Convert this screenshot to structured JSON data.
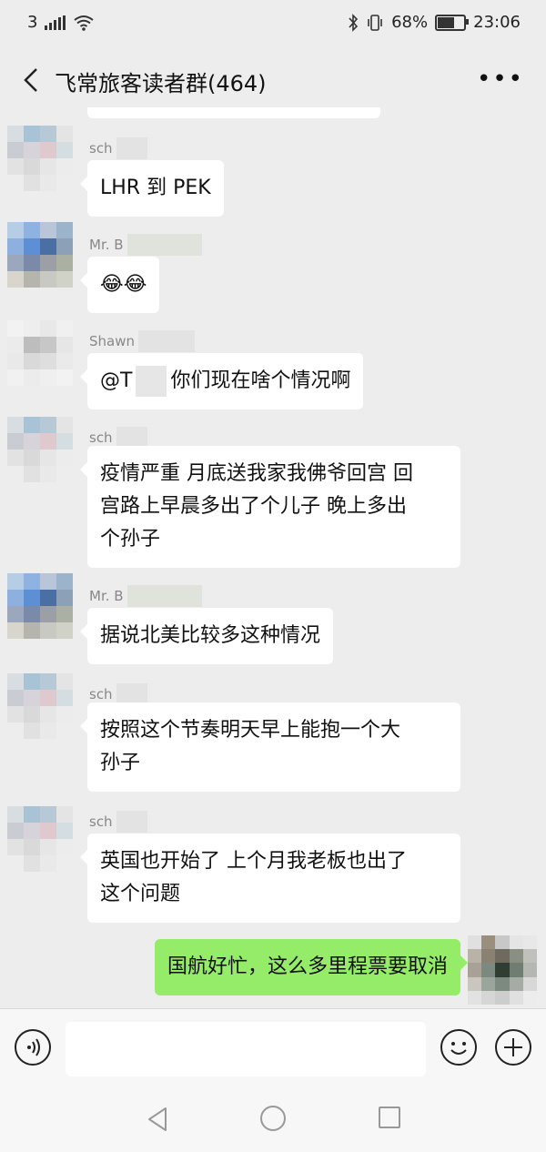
{
  "status_bar": {
    "carrier": "3",
    "battery": "68%",
    "battery_level": 0.68,
    "time": "23:06"
  },
  "header": {
    "title": "飞常旅客读者群(464)",
    "more": "•••"
  },
  "messages": [
    {
      "sender": "sch",
      "text": "LHR 到 PEK"
    },
    {
      "sender": "Mr. B",
      "text": "😂😂"
    },
    {
      "sender": "Shawn",
      "text_prefix": "@T",
      "text": "你们现在啥个情况啊"
    },
    {
      "sender": "sch",
      "lines": [
        "疫情严重 月底送我家我佛爷回宫 回",
        "宫路上早晨多出了个儿子 晚上多出",
        "个孙子"
      ]
    },
    {
      "sender": "Mr. B",
      "text": "据说北美比较多这种情况"
    },
    {
      "sender": "sch",
      "lines": [
        "按照这个节奏明天早上能抱一个大",
        "孙子"
      ]
    },
    {
      "sender": "sch",
      "lines": [
        "英国也开始了 上个月我老板也出了",
        "这个问题"
      ]
    },
    {
      "sender": "me",
      "text": "国航好忙，这么多里程票要取消"
    }
  ],
  "icons": {
    "back": "chevron-left-icon",
    "more": "more-dots-icon",
    "voice": "voice-icon",
    "emoji": "emoji-icon",
    "plus": "plus-icon"
  },
  "colors": {
    "my_bubble": "#95ec69",
    "background": "#ededed"
  }
}
